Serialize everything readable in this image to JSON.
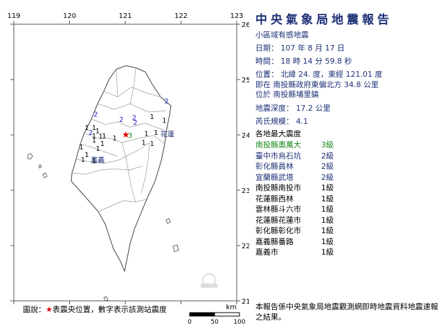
{
  "map": {
    "lon_ticks": [
      "119",
      "120",
      "121",
      "122",
      "123"
    ],
    "lat_ticks": [
      "26",
      "25",
      "24",
      "23",
      "22",
      "21"
    ],
    "place_labels": [
      "花蓮",
      "嘉義"
    ],
    "intensity_markers": [
      {
        "value": "2",
        "lon": 120.47,
        "lat": 24.33
      },
      {
        "value": "2",
        "lon": 120.93,
        "lat": 24.24
      },
      {
        "value": "2",
        "lon": 121.16,
        "lat": 24.27
      },
      {
        "value": "2",
        "lon": 121.18,
        "lat": 24.18
      },
      {
        "value": "2",
        "lon": 121.74,
        "lat": 24.57
      },
      {
        "value": "2",
        "lon": 120.38,
        "lat": 24.0
      },
      {
        "value": "3",
        "lon": 121.09,
        "lat": 23.95
      },
      {
        "value": "1",
        "lon": 121.48,
        "lat": 24.29
      },
      {
        "value": "1",
        "lon": 121.7,
        "lat": 24.22
      },
      {
        "value": "1",
        "lon": 121.55,
        "lat": 24.0
      },
      {
        "value": "1",
        "lon": 121.38,
        "lat": 23.98
      },
      {
        "value": "1",
        "lon": 121.33,
        "lat": 23.82
      },
      {
        "value": "1",
        "lon": 121.48,
        "lat": 23.8
      },
      {
        "value": "1",
        "lon": 120.31,
        "lat": 24.09
      },
      {
        "value": "1",
        "lon": 120.44,
        "lat": 24.09
      },
      {
        "value": "1",
        "lon": 120.5,
        "lat": 24.03
      },
      {
        "value": "1",
        "lon": 120.44,
        "lat": 23.94
      },
      {
        "value": "1",
        "lon": 120.56,
        "lat": 23.93
      },
      {
        "value": "1",
        "lon": 120.62,
        "lat": 23.94
      },
      {
        "value": "1",
        "lon": 120.44,
        "lat": 23.86
      },
      {
        "value": "1",
        "lon": 120.81,
        "lat": 23.9
      },
      {
        "value": "1",
        "lon": 120.59,
        "lat": 23.8
      },
      {
        "value": "1",
        "lon": 120.51,
        "lat": 23.71
      },
      {
        "value": "1",
        "lon": 120.21,
        "lat": 23.74
      },
      {
        "value": "1",
        "lon": 120.31,
        "lat": 23.6
      },
      {
        "value": "1",
        "lon": 120.24,
        "lat": 23.51
      },
      {
        "value": "1",
        "lon": 120.44,
        "lat": 23.49
      }
    ],
    "epicenter": {
      "lon": 121.01,
      "lat": 24.0
    },
    "scale": {
      "unit": "km",
      "ticks": [
        "0",
        "50",
        "100"
      ]
    },
    "colors": {
      "land_border": "#404040",
      "county_border": "#9a9a9a",
      "intensity_text": "#2020c0",
      "epicenter": "#e00000",
      "watermark": "#d0d0d0"
    }
  },
  "report": {
    "title": "中央氣象局地震報告",
    "subtitle": "小區域有感地震",
    "date": "日期： 107 年 8 月 17 日",
    "time": "時間： 18 時 14 分 59.8 秒",
    "location1": "位置： 北緯 24. 度，東經 121.01 度",
    "location2": "即在 南投縣政府東偏北方 34.8 公里",
    "location3": "位於 南投縣埔里鎮",
    "depth": "地震深度： 17.2 公里",
    "magnitude": "芮氏規模： 4.1",
    "max_intensity_heading": "各地最大震度",
    "stations": [
      {
        "name": "南投縣奧萬大",
        "intensity": "3級",
        "color": "#1a8a1a"
      },
      {
        "name": "臺中市烏石坑",
        "intensity": "2級",
        "color": "#1c2f75"
      },
      {
        "name": "彰化縣員林",
        "intensity": "2級",
        "color": "#1c2f75"
      },
      {
        "name": "宜蘭縣武塔",
        "intensity": "2級",
        "color": "#1c2f75"
      },
      {
        "name": "南投縣南投市",
        "intensity": "1級",
        "color": "#000000"
      },
      {
        "name": "花蓮縣西林",
        "intensity": "1級",
        "color": "#000000"
      },
      {
        "name": "雲林縣斗六市",
        "intensity": "1級",
        "color": "#000000"
      },
      {
        "name": "花蓮縣花蓮市",
        "intensity": "1級",
        "color": "#000000"
      },
      {
        "name": "彰化縣彰化市",
        "intensity": "1級",
        "color": "#000000"
      },
      {
        "name": "嘉義縣番路",
        "intensity": "1級",
        "color": "#000000"
      },
      {
        "name": "嘉義市",
        "intensity": "1級",
        "color": "#000000"
      }
    ],
    "footer": "本報告係中央氣象局地震觀測網即時地震資料地震速報之結果。"
  },
  "legend": {
    "prefix": "圖說：",
    "star": "★",
    "text": "表震央位置，數字表示該測站震度"
  }
}
